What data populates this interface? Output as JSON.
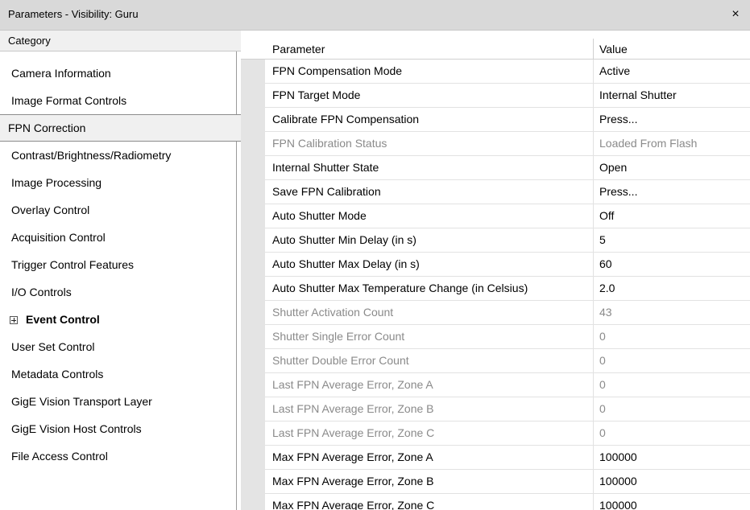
{
  "window": {
    "title": "Parameters - Visibility: Guru",
    "close_glyph": "×"
  },
  "category_panel": {
    "header": "Category",
    "items": [
      {
        "label": "Camera Information",
        "selected": false,
        "bold": false,
        "expander": false
      },
      {
        "label": "Image Format Controls",
        "selected": false,
        "bold": false,
        "expander": false
      },
      {
        "label": "FPN Correction",
        "selected": true,
        "bold": false,
        "expander": false
      },
      {
        "label": "Contrast/Brightness/Radiometry",
        "selected": false,
        "bold": false,
        "expander": false
      },
      {
        "label": "Image Processing",
        "selected": false,
        "bold": false,
        "expander": false
      },
      {
        "label": "Overlay Control",
        "selected": false,
        "bold": false,
        "expander": false
      },
      {
        "label": "Acquisition Control",
        "selected": false,
        "bold": false,
        "expander": false
      },
      {
        "label": "Trigger Control Features",
        "selected": false,
        "bold": false,
        "expander": false
      },
      {
        "label": "I/O Controls",
        "selected": false,
        "bold": false,
        "expander": false
      },
      {
        "label": "Event Control",
        "selected": false,
        "bold": true,
        "expander": true
      },
      {
        "label": "User Set Control",
        "selected": false,
        "bold": false,
        "expander": false
      },
      {
        "label": "Metadata Controls",
        "selected": false,
        "bold": false,
        "expander": false
      },
      {
        "label": "GigE Vision Transport Layer",
        "selected": false,
        "bold": false,
        "expander": false
      },
      {
        "label": "GigE Vision Host Controls",
        "selected": false,
        "bold": false,
        "expander": false
      },
      {
        "label": "File Access Control",
        "selected": false,
        "bold": false,
        "expander": false
      }
    ]
  },
  "parameter_panel": {
    "header_parameter": "Parameter",
    "header_value": "Value",
    "rows": [
      {
        "parameter": "FPN Compensation Mode",
        "value": "Active",
        "enabled": true
      },
      {
        "parameter": "FPN Target Mode",
        "value": "Internal Shutter",
        "enabled": true
      },
      {
        "parameter": "Calibrate FPN Compensation",
        "value": "Press...",
        "enabled": true
      },
      {
        "parameter": "FPN Calibration Status",
        "value": "Loaded From Flash",
        "enabled": false
      },
      {
        "parameter": "Internal Shutter State",
        "value": "Open",
        "enabled": true
      },
      {
        "parameter": "Save FPN Calibration",
        "value": "Press...",
        "enabled": true
      },
      {
        "parameter": "Auto Shutter Mode",
        "value": "Off",
        "enabled": true
      },
      {
        "parameter": "Auto Shutter Min Delay (in s)",
        "value": "5",
        "enabled": true
      },
      {
        "parameter": "Auto Shutter Max Delay (in s)",
        "value": "60",
        "enabled": true
      },
      {
        "parameter": "Auto Shutter Max Temperature Change (in Celsius)",
        "value": "2.0",
        "enabled": true
      },
      {
        "parameter": "Shutter Activation Count",
        "value": "43",
        "enabled": false
      },
      {
        "parameter": "Shutter Single Error Count",
        "value": "0",
        "enabled": false
      },
      {
        "parameter": "Shutter Double Error Count",
        "value": "0",
        "enabled": false
      },
      {
        "parameter": "Last FPN Average Error, Zone A",
        "value": "0",
        "enabled": false
      },
      {
        "parameter": "Last FPN Average Error, Zone B",
        "value": "0",
        "enabled": false
      },
      {
        "parameter": "Last FPN Average Error, Zone C",
        "value": "0",
        "enabled": false
      },
      {
        "parameter": "Max FPN Average Error, Zone A",
        "value": "100000",
        "enabled": true
      },
      {
        "parameter": "Max FPN Average Error, Zone B",
        "value": "100000",
        "enabled": true
      },
      {
        "parameter": "Max FPN Average Error, Zone C",
        "value": "100000",
        "enabled": true
      }
    ]
  }
}
